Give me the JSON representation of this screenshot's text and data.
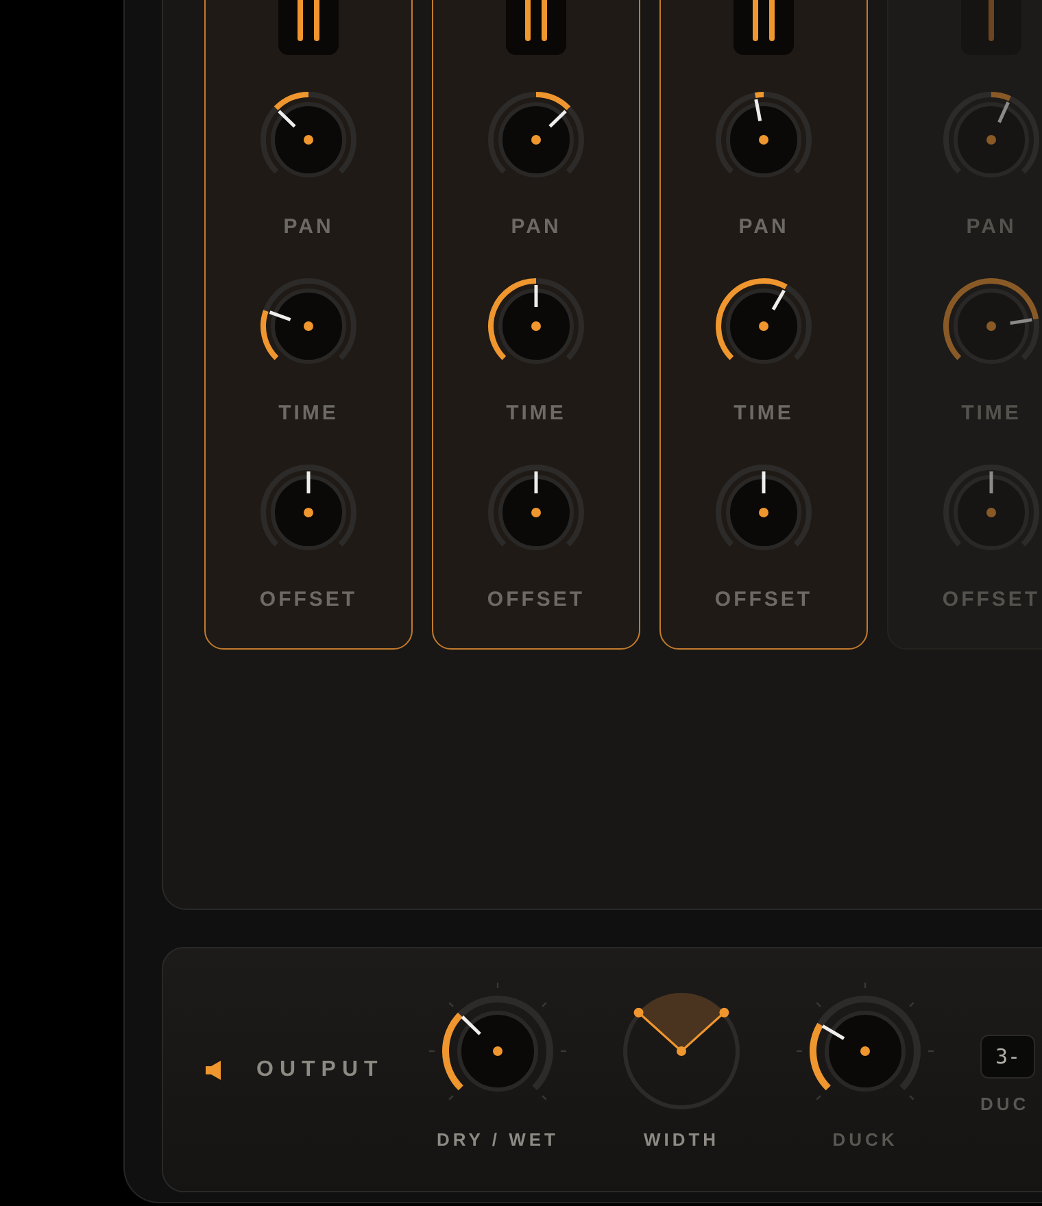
{
  "channels": [
    {
      "active": true,
      "knobs": [
        {
          "kind": "bipolar",
          "label": "PAN",
          "level": 0.33
        },
        {
          "kind": "unipolar",
          "label": "TIME",
          "level": 0.24
        },
        {
          "kind": "bipolar",
          "label": "OFFSET",
          "level": 0.5
        }
      ]
    },
    {
      "active": true,
      "knobs": [
        {
          "kind": "bipolar",
          "label": "PAN",
          "level": 0.67
        },
        {
          "kind": "unipolar",
          "label": "TIME",
          "level": 0.5
        },
        {
          "kind": "bipolar",
          "label": "OFFSET",
          "level": 0.5
        }
      ]
    },
    {
      "active": true,
      "knobs": [
        {
          "kind": "bipolar",
          "label": "PAN",
          "level": 0.46
        },
        {
          "kind": "unipolar",
          "label": "TIME",
          "level": 0.61
        },
        {
          "kind": "bipolar",
          "label": "OFFSET",
          "level": 0.5
        }
      ]
    },
    {
      "active": false,
      "knobs": [
        {
          "kind": "bipolar",
          "label": "PAN",
          "level": 0.59
        },
        {
          "kind": "unipolar",
          "label": "TIME",
          "level": 0.8
        },
        {
          "kind": "bipolar",
          "label": "OFFSET",
          "level": 0.5
        }
      ]
    }
  ],
  "output": {
    "label": "OUTPUT",
    "controls": [
      {
        "kind": "knob",
        "label": "DRY / WET",
        "level": 0.33,
        "dimmed": false
      },
      {
        "kind": "width",
        "label": "WIDTH",
        "level": 0.5,
        "dimmed": false
      },
      {
        "kind": "knob",
        "label": "DUCK",
        "level": 0.28,
        "dimmed": true
      },
      {
        "kind": "display",
        "label": "DUC",
        "value": "3-",
        "dimmed": true
      }
    ]
  }
}
